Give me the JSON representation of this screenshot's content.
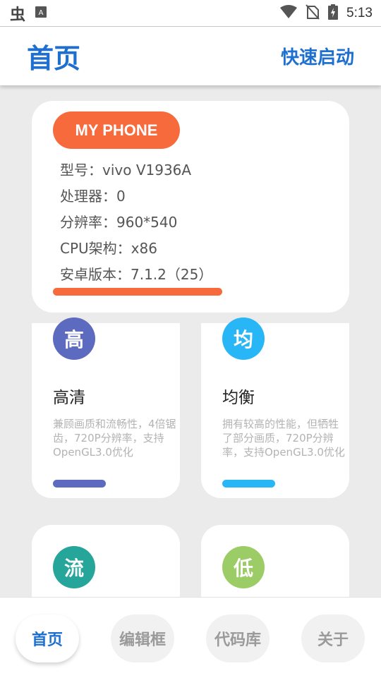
{
  "status_bar": {
    "time": "5:13",
    "app_icon_1": "chinese-character-app-icon",
    "app_icon_2": "text-a-app-icon"
  },
  "app_bar": {
    "title": "首页",
    "action": "快速启动"
  },
  "phone_card": {
    "badge": "MY PHONE",
    "rows": [
      "型号：vivo V1936A",
      "处理器：0",
      "分辨率：960*540",
      "CPU架构：x86",
      "安卓版本：7.1.2（25）"
    ],
    "accent_color": "#f76a3c"
  },
  "modes": [
    {
      "icon_char": "高",
      "title": "高清",
      "description": "兼顾画质和流畅性，4倍锯齿，720P分辨率，支持OpenGL3.0优化",
      "color": "#5c6bc0"
    },
    {
      "icon_char": "均",
      "title": "均衡",
      "description": "拥有较高的性能，但牺牲了部分画质，720P分辨率，支持OpenGL3.0优化",
      "color": "#29b6f6"
    },
    {
      "icon_char": "流",
      "color": "#26a69a"
    },
    {
      "icon_char": "低",
      "color": "#9ccc65"
    }
  ],
  "bottom_nav": {
    "items": [
      "首页",
      "编辑框",
      "代码库",
      "关于"
    ],
    "active": "首页"
  }
}
